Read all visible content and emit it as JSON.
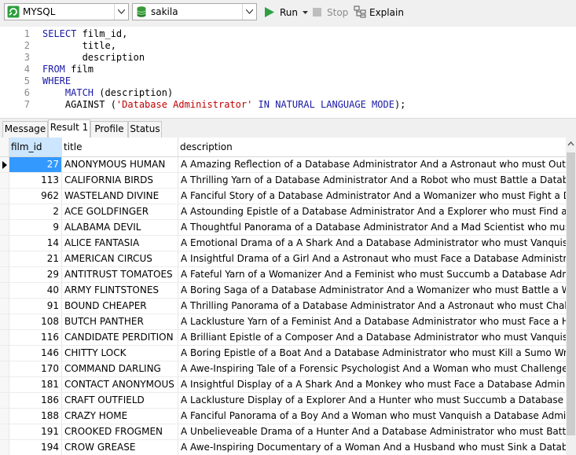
{
  "toolbar": {
    "connection": "MYSQL",
    "database": "sakila",
    "run_label": "Run",
    "stop_label": "Stop",
    "explain_label": "Explain"
  },
  "editor": {
    "lines": [
      {
        "n": "1",
        "parts": [
          {
            "t": "SELECT",
            "c": "kw"
          },
          {
            "t": " film_id,",
            "c": ""
          }
        ]
      },
      {
        "n": "2",
        "parts": [
          {
            "t": "       title,",
            "c": ""
          }
        ]
      },
      {
        "n": "3",
        "parts": [
          {
            "t": "       description",
            "c": ""
          }
        ]
      },
      {
        "n": "4",
        "parts": [
          {
            "t": "FROM",
            "c": "kw"
          },
          {
            "t": " film",
            "c": ""
          }
        ]
      },
      {
        "n": "5",
        "parts": [
          {
            "t": "WHERE",
            "c": "kw"
          }
        ]
      },
      {
        "n": "6",
        "parts": [
          {
            "t": "    ",
            "c": ""
          },
          {
            "t": "MATCH",
            "c": "fn"
          },
          {
            "t": " (description)",
            "c": ""
          }
        ]
      },
      {
        "n": "7",
        "parts": [
          {
            "t": "    AGAINST (",
            "c": ""
          },
          {
            "t": "'Database Administrator'",
            "c": "str"
          },
          {
            "t": " ",
            "c": ""
          },
          {
            "t": "IN NATURAL LANGUAGE MODE",
            "c": "kw"
          },
          {
            "t": ");",
            "c": ""
          }
        ]
      }
    ]
  },
  "tabs": [
    {
      "label": "Message",
      "active": false
    },
    {
      "label": "Result 1",
      "active": true
    },
    {
      "label": "Profile",
      "active": false
    },
    {
      "label": "Status",
      "active": false
    }
  ],
  "grid": {
    "columns": [
      "film_id",
      "title",
      "description"
    ],
    "rows": [
      [
        "27",
        "ANONYMOUS HUMAN",
        "A Amazing Reflection of a Database Administrator And a Astronaut who must Outrace a Data"
      ],
      [
        "113",
        "CALIFORNIA BIRDS",
        "A Thrilling Yarn of a Database Administrator And a Robot who must Battle a Database Admin"
      ],
      [
        "962",
        "WASTELAND DIVINE",
        "A Fanciful Story of a Database Administrator And a Womanizer who must Fight a Database Ac"
      ],
      [
        "2",
        "ACE GOLDFINGER",
        "A Astounding Epistle of a Database Administrator And a Explorer who must Find a Car in Anci"
      ],
      [
        "9",
        "ALABAMA DEVIL",
        "A Thoughtful Panorama of a Database Administrator And a Mad Scientist who must Outgun"
      ],
      [
        "14",
        "ALICE FANTASIA",
        "A Emotional Drama of a A Shark And a Database Administrator who must Vanquish a Pioneer"
      ],
      [
        "21",
        "AMERICAN CIRCUS",
        "A Insightful Drama of a Girl And a Astronaut who must Face a Database Administrator in A Sh"
      ],
      [
        "29",
        "ANTITRUST TOMATOES",
        "A Fateful Yarn of a Womanizer And a Feminist who must Succumb a Database Administrator"
      ],
      [
        "40",
        "ARMY FLINTSTONES",
        "A Boring Saga of a Database Administrator And a Womanizer who must Battle a Waitress in N"
      ],
      [
        "91",
        "BOUND CHEAPER",
        "A Thrilling Panorama of a Database Administrator And a Astronaut who must Challenge a Lu"
      ],
      [
        "108",
        "BUTCH PANTHER",
        "A Lacklusture Yarn of a Feminist And a Database Administrator who must Face a Hunter in Ne"
      ],
      [
        "116",
        "CANDIDATE PERDITION",
        "A Brilliant Epistle of a Composer And a Database Administrator who must Vanquish a Mad Sc"
      ],
      [
        "146",
        "CHITTY LOCK",
        "A Boring Epistle of a Boat And a Database Administrator who must Kill a Sumo Wrestler in The"
      ],
      [
        "170",
        "COMMAND DARLING",
        "A Awe-Inspiring Tale of a Forensic Psychologist And a Woman who must Challenge a Databa"
      ],
      [
        "181",
        "CONTACT ANONYMOUS",
        "A Insightful Display of a A Shark And a Monkey who must Face a Database Administrator in A"
      ],
      [
        "186",
        "CRAFT OUTFIELD",
        "A Lacklusture Display of a Explorer And a Hunter who must Succumb a Database Administrato"
      ],
      [
        "188",
        "CRAZY HOME",
        "A Fanciful Panorama of a Boy And a Woman who must Vanquish a Database Administrator in"
      ],
      [
        "191",
        "CROOKED FROGMEN",
        "A Unbelieveable Drama of a Hunter And a Database Administrator who must Battle a Crocodi"
      ],
      [
        "194",
        "CROW GREASE",
        "A Awe-Inspiring Documentary of a Woman And a Husband who must Sink a Database Admir"
      ]
    ]
  },
  "colors": {
    "selected_cell": "#3399ff",
    "selected_header": "#cce6ff",
    "keyword": "#1a1aa6",
    "string": "#c00000",
    "run_icon": "#2ea043"
  }
}
